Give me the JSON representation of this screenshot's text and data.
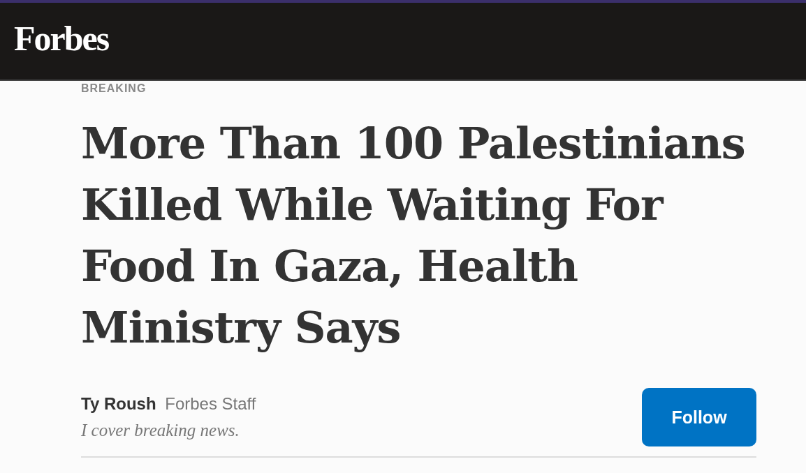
{
  "header": {
    "logo": "Forbes"
  },
  "article": {
    "section": "BREAKING",
    "headline": "More Than 100 Palestinians Killed While Waiting For Food In Gaza, Health Ministry Says",
    "author": {
      "name": "Ty Roush",
      "role": "Forbes Staff",
      "bio": "I cover breaking news."
    },
    "follow_button": "Follow"
  }
}
